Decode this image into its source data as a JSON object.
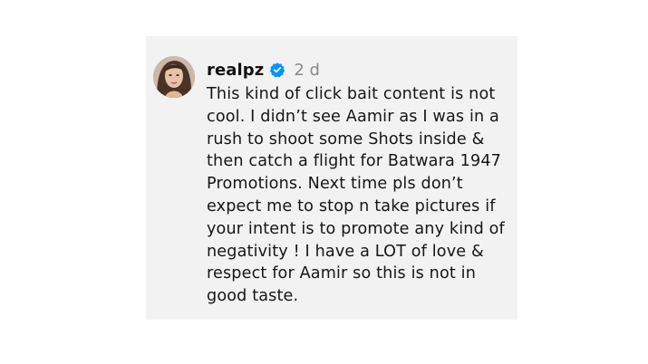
{
  "comment": {
    "username": "realpz",
    "verified_icon": "verified-badge-icon",
    "timestamp": "2 d",
    "lines": [
      "This kind of click bait content is not",
      "cool. I didn’t see Aamir as I was in a",
      "rush to shoot some Shots inside &",
      "then catch a flight for Batwara 1947",
      "Promotions. Next time pls don’t",
      "expect me to stop n take pictures if",
      "your intent is to promote any kind of",
      "negativity ! I have a LOT of love &",
      "respect for Aamir so this is not in",
      "good taste."
    ]
  },
  "colors": {
    "card_background": "#f2f2f2",
    "verified_blue": "#0095f6",
    "timestamp_gray": "#8a8a8a",
    "text": "#161616"
  }
}
